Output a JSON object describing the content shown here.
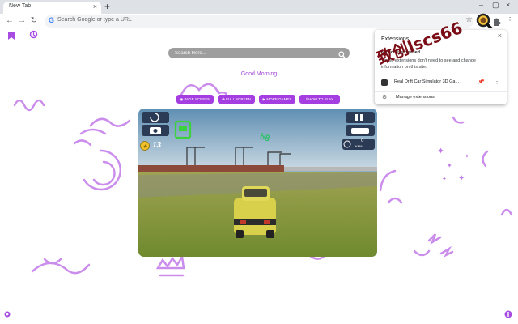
{
  "browser": {
    "tab_title": "New Tab",
    "tab_close": "×",
    "new_tab": "+",
    "window_controls": [
      "–",
      "▢",
      "×"
    ],
    "address_placeholder": "Search Google or type a URL",
    "google_letter": "G",
    "icons": [
      "back-icon",
      "forward-icon",
      "reload-icon",
      "star-icon",
      "extension-puzzle-icon",
      "kebab-menu-icon",
      "magnifier-extension-icon"
    ]
  },
  "page": {
    "search_placeholder": "Search Here...",
    "greeting": "Good Morning",
    "buttons": [
      {
        "label": "PAGE SCREEN"
      },
      {
        "label": "FULL SCREEN"
      },
      {
        "label": "MORE GAMES"
      },
      {
        "label": "HOW TO PLAY"
      }
    ],
    "accent_color": "#a43ee0",
    "game": {
      "star_count": "13",
      "drift_points": "58",
      "speed": "0",
      "speed_unit": "KM/H"
    }
  },
  "extensions_popup": {
    "title": "Extensions",
    "close": "×",
    "heading": "No access needed",
    "description": "These extensions don't need to see and change information on this site.",
    "item_name": "Real Drift Car Simulator 3D Ga...",
    "manage_label": "Manage extensions"
  },
  "watermark": "致创Iscs66"
}
